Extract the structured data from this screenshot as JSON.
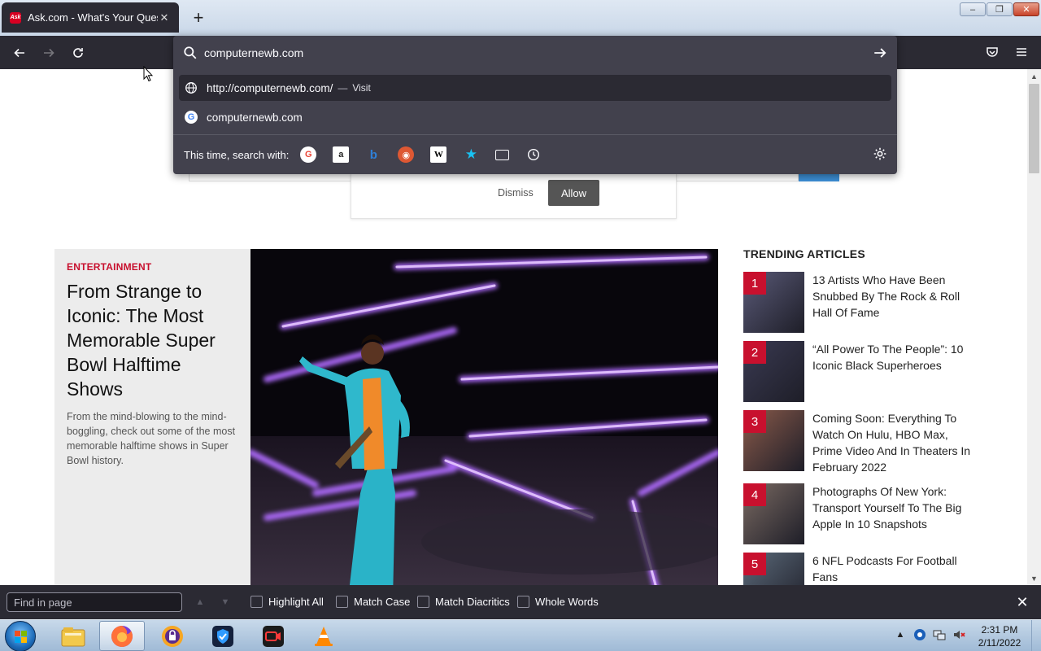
{
  "browser": {
    "tab_title": "Ask.com - What's Your Question?",
    "tab_favicon_text": "Ask",
    "new_tab_symbol": "+",
    "window_controls": {
      "minimize": "–",
      "maximize": "❐",
      "close": "✕"
    }
  },
  "urlbar": {
    "value": "computernewb.com",
    "suggestions": [
      {
        "text": "http://computernewb.com/",
        "sep": "—",
        "action": "Visit",
        "icon": "globe-icon"
      },
      {
        "text": "computernewb.com",
        "icon": "google-icon"
      }
    ],
    "one_off_label": "This time, search with:",
    "engines": [
      {
        "name": "google",
        "glyph": "G"
      },
      {
        "name": "amazon",
        "glyph": "a"
      },
      {
        "name": "bing",
        "glyph": "b"
      },
      {
        "name": "duckduckgo",
        "glyph": "◉"
      },
      {
        "name": "wikipedia",
        "glyph": "W"
      },
      {
        "name": "bookmarks",
        "glyph": "★"
      },
      {
        "name": "tabs",
        "glyph": ""
      },
      {
        "name": "history",
        "glyph": "🕓"
      }
    ]
  },
  "notification": {
    "dismiss": "Dismiss",
    "allow": "Allow"
  },
  "feature": {
    "category": "ENTERTAINMENT",
    "headline": "From Strange to Iconic: The Most Memorable Super Bowl Halftime Shows",
    "summary": "From the mind-blowing to the mind-boggling, check out some of the most memorable halftime shows in Super Bowl history."
  },
  "trending": {
    "title": "TRENDING ARTICLES",
    "items": [
      {
        "num": "1",
        "text": "13 Artists Who Have Been Snubbed By The Rock & Roll Hall Of Fame",
        "color": "#5a5a78"
      },
      {
        "num": "2",
        "text": "“All Power To The People”: 10 Iconic Black Superheroes",
        "color": "#3a3a52"
      },
      {
        "num": "3",
        "text": "Coming Soon: Everything To Watch On Hulu, HBO Max, Prime Video And In Theaters In February 2022",
        "color": "#8a5a4a"
      },
      {
        "num": "4",
        "text": "Photographs Of New York: Transport Yourself To The Big Apple In 10 Snapshots",
        "color": "#7a6a62"
      },
      {
        "num": "5",
        "text": "6 NFL Podcasts For Football Fans",
        "color": "#5b6a7a"
      }
    ]
  },
  "findbar": {
    "placeholder": "Find in page",
    "options": [
      "Highlight All",
      "Match Case",
      "Match Diacritics",
      "Whole Words"
    ],
    "close": "✕"
  },
  "taskbar": {
    "time": "2:31 PM",
    "date": "2/11/2022",
    "apps": [
      "file-explorer",
      "firefox",
      "vpn-app",
      "shield-app",
      "screen-recorder",
      "vlc"
    ]
  }
}
